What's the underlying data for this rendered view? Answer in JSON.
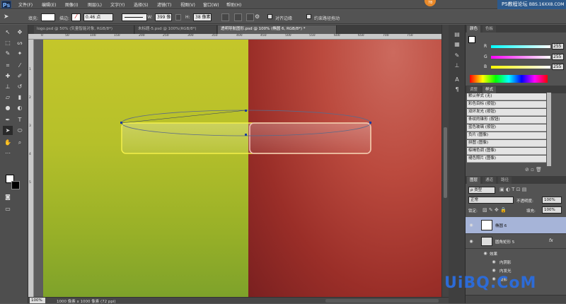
{
  "app": {
    "logo": "Ps"
  },
  "menu": [
    "文件(F)",
    "编辑(E)",
    "图像(I)",
    "图层(L)",
    "文字(Y)",
    "选择(S)",
    "滤镜(T)",
    "视图(V)",
    "窗口(W)",
    "帮助(H)"
  ],
  "watermark_top": {
    "badge": "78",
    "site": "PS教程论坛",
    "url": "BBS.16XX8.COM"
  },
  "options": {
    "fill_label": "填充:",
    "stroke_label": "描边:",
    "stroke_width": "0.46 点",
    "w_label": "W:",
    "w_value": "399 像",
    "h_label": "H:",
    "h_value": "38 像素",
    "align_edges": "对齐边缘",
    "constrain_path": "约束路径拖动"
  },
  "tabs": [
    {
      "label": "logo.psd @ 50% (矢量智能对象, RGB/8*)",
      "active": false
    },
    {
      "label": "未标题-5.psd @ 100%(RGB/8*)",
      "active": false
    },
    {
      "label": "透明导航图形.psd @ 100% (椭圆 6, RGB/8*) *",
      "active": true
    }
  ],
  "ruler_top": [
    "0",
    "50",
    "100",
    "150",
    "200",
    "250",
    "300",
    "350",
    "400",
    "450",
    "500",
    "550",
    "600",
    "650",
    "700",
    "750"
  ],
  "ruler_left": [
    "1",
    "2",
    "3",
    "4",
    "5"
  ],
  "status": {
    "zoom": "100%",
    "doc": "1000 像素 x 1000 像素 (72 ppi)"
  },
  "color_panel": {
    "tabs": [
      "颜色",
      "色板"
    ],
    "r_label": "R",
    "r_value": "255",
    "g_label": "G",
    "g_value": "255",
    "b_label": "B",
    "b_value": "255"
  },
  "styles_panel": {
    "tabs": [
      "调整",
      "样式"
    ],
    "items": [
      "默认样式 (无)",
      "彩色目标 (按钮)",
      "双环发光 (按钮)",
      "条纹的锥形 (按钮)",
      "蓝色玻璃 (按钮)",
      "负片 (图像)",
      "拼图 (图像)",
      "棕褐色调 (图像)",
      "褪色照片 (图像)"
    ]
  },
  "layers_panel": {
    "tabs": [
      "图层",
      "通道",
      "路径"
    ],
    "kind": "ρ 类型",
    "blend": "正常",
    "opacity_label": "不透明度:",
    "opacity": "100%",
    "lock_label": "锁定:",
    "fill_label": "填充:",
    "fill": "100%",
    "layers": [
      {
        "name": "椭圆 6",
        "selected": true
      },
      {
        "name": "圆角矩形 5",
        "selected": false
      }
    ],
    "effects_label": "效果",
    "effects": [
      "内阴影",
      "内发光",
      "投影"
    ],
    "fx": "fx"
  },
  "watermark_bottom": "UiBQ.CoM"
}
